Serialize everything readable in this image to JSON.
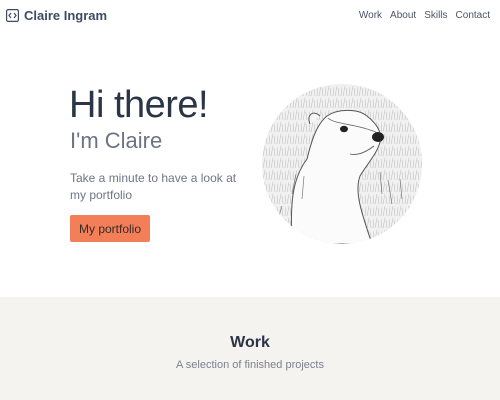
{
  "nav": {
    "brand": "Claire Ingram",
    "brand_icon": "code-brackets-icon",
    "links": [
      "Work",
      "About",
      "Skills",
      "Contact"
    ]
  },
  "hero": {
    "greeting": "Hi there!",
    "intro": "I'm Claire",
    "description": "Take a minute to have a look at my portfolio",
    "cta_label": "My portfolio",
    "avatar_icon": "polar-bear-illustration"
  },
  "work_section": {
    "title": "Work",
    "subtitle": "A selection of finished projects"
  },
  "colors": {
    "accent": "#f37f59",
    "section_bg": "#f4f3ef",
    "text_dark": "#2b3545"
  }
}
